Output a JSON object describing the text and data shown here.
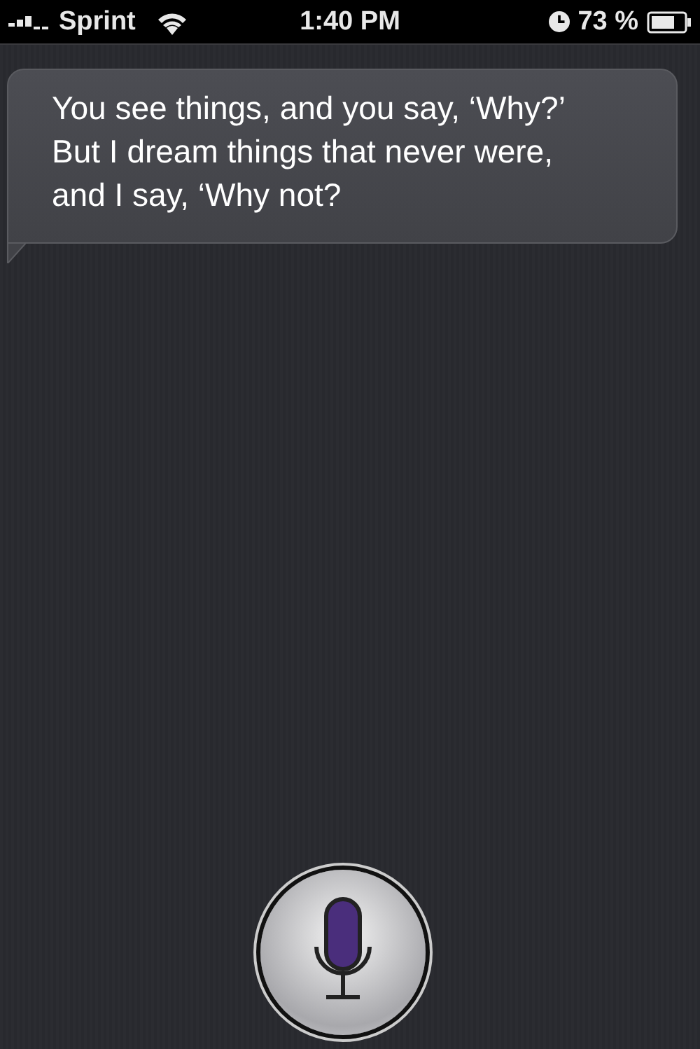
{
  "status_bar": {
    "carrier": "Sprint",
    "time": "1:40 PM",
    "battery": "73 %"
  },
  "message": {
    "text": "You see things, and you say, ‘Why?’ But I dream things that never were, and I say, ‘Why not?"
  }
}
